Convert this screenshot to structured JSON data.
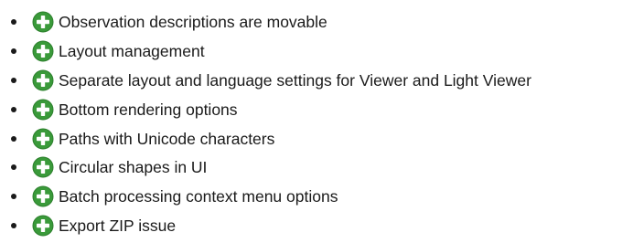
{
  "icon": {
    "name": "plus-icon",
    "fill": "#3a9a3a",
    "stroke": "#2c7f2c",
    "glyph_color": "#ffffff"
  },
  "items": [
    {
      "label": "Observation descriptions are movable"
    },
    {
      "label": "Layout management"
    },
    {
      "label": "Separate layout and language settings for Viewer and Light Viewer"
    },
    {
      "label": "Bottom rendering options"
    },
    {
      "label": "Paths with Unicode characters"
    },
    {
      "label": "Circular shapes in UI"
    },
    {
      "label": "Batch processing context menu options"
    },
    {
      "label": "Export ZIP issue"
    }
  ]
}
